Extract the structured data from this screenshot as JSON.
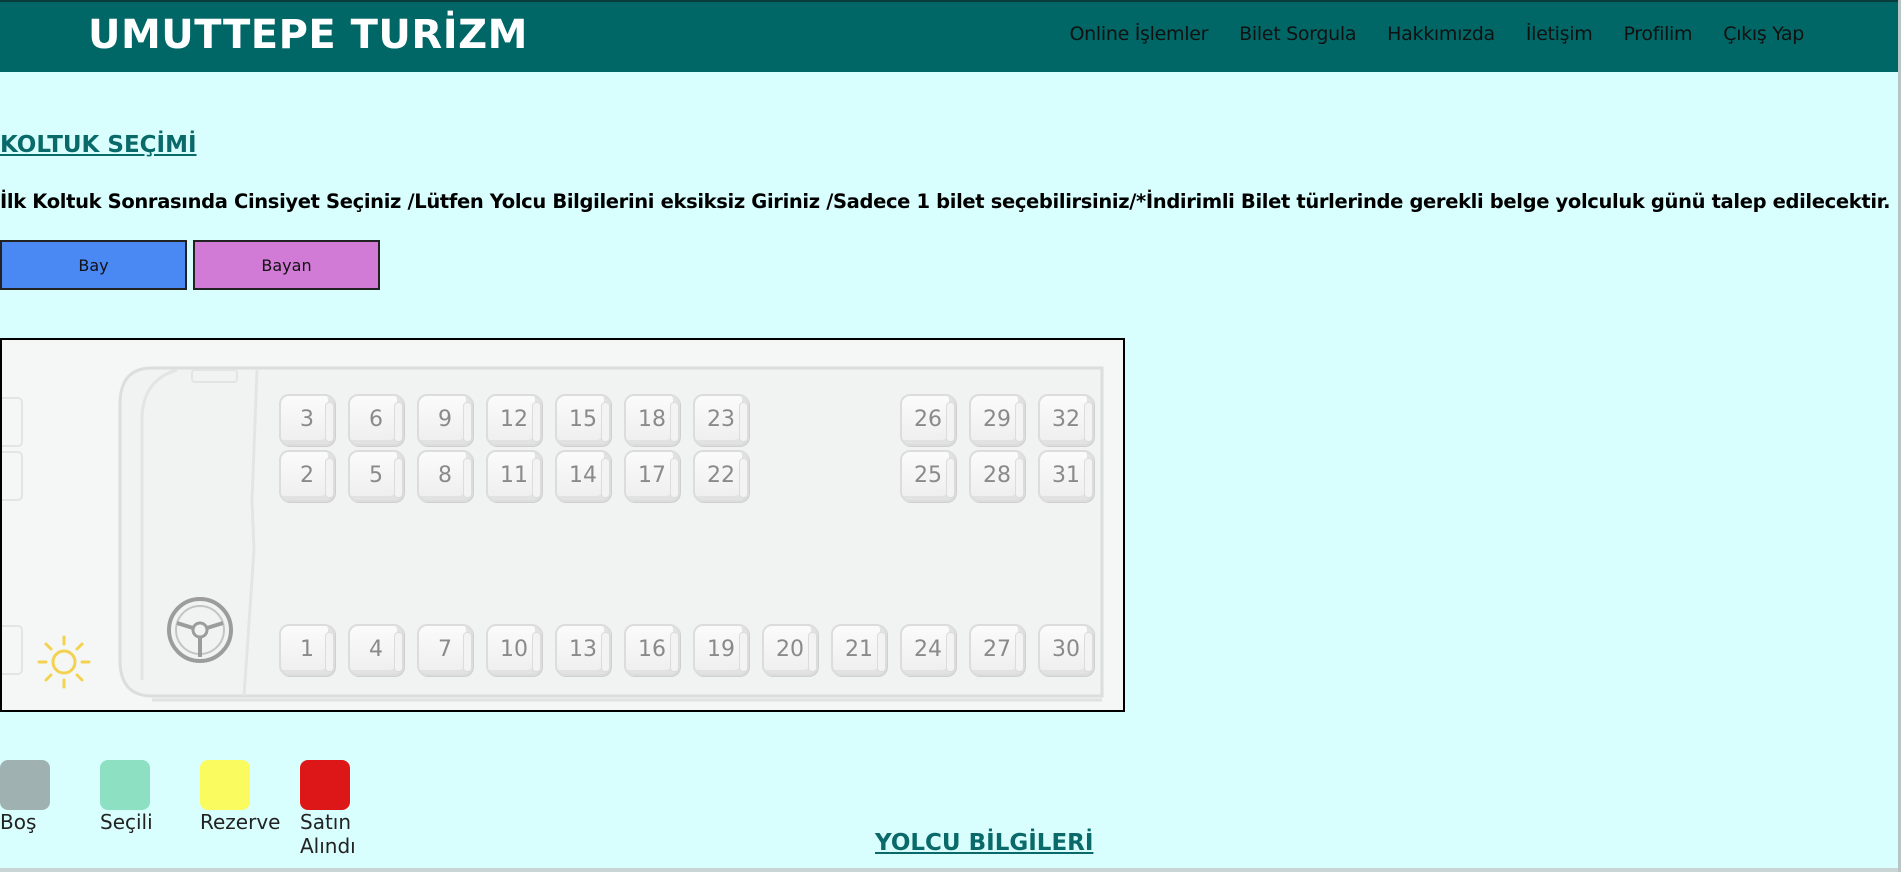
{
  "navbar": {
    "brand": "UMUTTEPE TURİZM",
    "links": [
      "Online İşlemler",
      "Bilet Sorgula",
      "Hakkımızda",
      "İletişim",
      "Profilim",
      "Çıkış Yap"
    ]
  },
  "seat_selection": {
    "title": "KOLTUK SEÇİMİ",
    "instructions": "İlk Koltuk Sonrasında Cinsiyet Seçiniz /Lütfen Yolcu Bilgilerini eksiksiz Giriniz /Sadece 1 bilet seçebilirsiniz/*İndirimli Bilet türlerinde gerekli belge yolculuk günü talep edilecektir.",
    "gender_buttons": {
      "male": "Bay",
      "female": "Bayan"
    },
    "seats": {
      "top_row": [
        "3",
        "6",
        "9",
        "12",
        "15",
        "18",
        "23",
        "26",
        "29",
        "32"
      ],
      "middle_row": [
        "2",
        "5",
        "8",
        "11",
        "14",
        "17",
        "22",
        "25",
        "28",
        "31"
      ],
      "bottom_row": [
        "1",
        "4",
        "7",
        "10",
        "13",
        "16",
        "19",
        "20",
        "21",
        "24",
        "27",
        "30"
      ]
    }
  },
  "legend": [
    {
      "label": "Boş",
      "color": "#9fb1b0"
    },
    {
      "label": "Seçili",
      "color": "#8de0c2"
    },
    {
      "label": "Rezerve",
      "color": "#fafb5e"
    },
    {
      "label": "Satın Alındı",
      "color": "#dd1717"
    }
  ],
  "passenger_info": {
    "title": "YOLCU BİLGİLERİ"
  },
  "colors": {
    "navbar": "#006666",
    "page_background": "#d8fefe",
    "accent": "#0a6a6a"
  }
}
